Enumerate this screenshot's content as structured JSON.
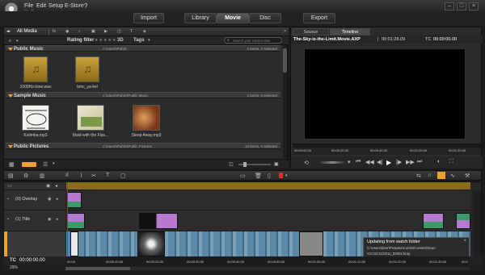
{
  "menu": [
    "File",
    "Edit",
    "Setup",
    "E-Store"
  ],
  "modes": {
    "import": "Import",
    "library": "Library",
    "movie": "Movie",
    "disc": "Disc",
    "export": "Export"
  },
  "library": {
    "all_media": "All Media",
    "rating_filter": "Rating filter",
    "threeD": "3D",
    "tags": "Tags",
    "search_placeholder": "Search your current view",
    "sections": [
      {
        "name": "Public Music",
        "path": "c:\\Users\\Public",
        "count": "2 items, 0 selected"
      },
      {
        "name": "Sample Music",
        "path": "c:\\Users\\Public\\Public Music",
        "count": "3 items, 0 selected"
      },
      {
        "name": "Public Pictures",
        "path": "c:\\Users\\Public\\Public Pictures",
        "count": "12 items, 0 selected"
      }
    ],
    "public_music_items": [
      "1000Hz-tone.wav",
      "bmc_ya-kel"
    ],
    "sample_music_items": [
      "Kalimba.mp3",
      "Maid with the Flax...",
      "Sleep Away.mp3"
    ]
  },
  "player": {
    "tab_source": "Source",
    "tab_timeline": "Timeline",
    "project_name": "The-Sky-is-the-Limit.Movie.AXP",
    "duration": "00:01:28.09",
    "tc_label": "TC",
    "tc_value": "00:00:00.00",
    "ruler": [
      "00:00:00.00",
      "00:00:20.00",
      "00:00:40.00",
      "00:01:00.00",
      "00:01:20.00"
    ]
  },
  "timeline": {
    "tracks": [
      {
        "name": "(0) Overlay"
      },
      {
        "name": "(1) Title"
      }
    ],
    "tc_label": "TC",
    "tc_value": "00:00:00.00",
    "zoom": "29%",
    "ruler": [
      "00:00",
      "00:00:10.00",
      "00:00:20.00",
      "00:00:30.00",
      "00:00:40.00",
      "00:00:50.00",
      "00:01:00.00",
      "00:01:10.00",
      "00:01:20.00",
      "00:01:30.00",
      "00:0"
    ],
    "status_title": "Updating from watch folder",
    "status_path_1": "C:\\Users\\Ziorr\\Pictures\\ControlCenter3\\Scan",
    "status_path_2": "\\CC32211\\2011_00002.bmp"
  },
  "colors": {
    "accent": "#f0a030",
    "playhead": "#e02020",
    "audio_clip": "#5a8aa8",
    "title_clip": "#9a6ab0",
    "track_bar": "#8a6d1c"
  }
}
